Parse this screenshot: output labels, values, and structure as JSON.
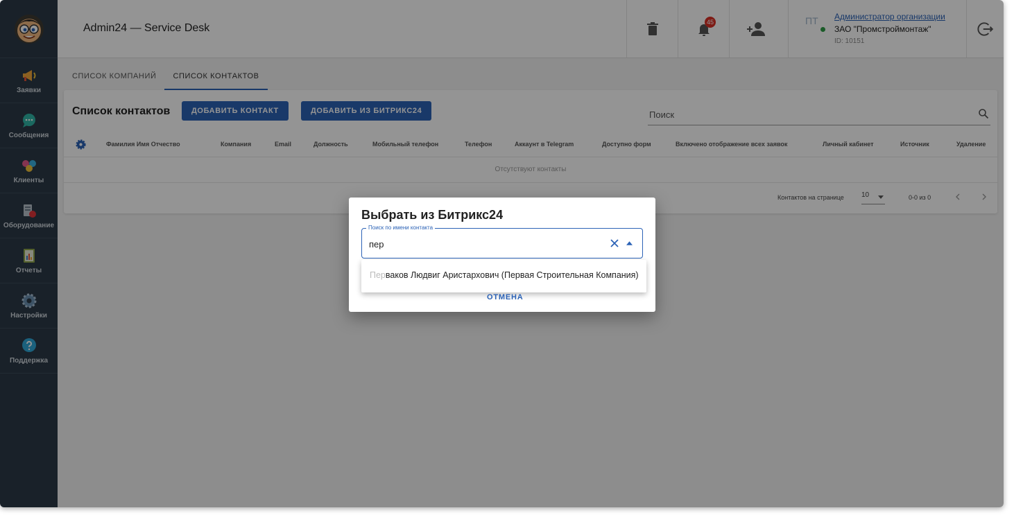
{
  "app": {
    "title": "Admin24 — Service Desk"
  },
  "sidebar": {
    "items": [
      {
        "label": "Заявки",
        "icon": "megaphone-icon"
      },
      {
        "label": "Сообщения",
        "icon": "chat-bubble-icon"
      },
      {
        "label": "Клиенты",
        "icon": "clients-icon"
      },
      {
        "label": "Оборудование",
        "icon": "equipment-icon"
      },
      {
        "label": "Отчеты",
        "icon": "report-icon"
      },
      {
        "label": "Настройки",
        "icon": "gear-icon"
      },
      {
        "label": "Поддержка",
        "icon": "help-icon"
      }
    ]
  },
  "header": {
    "notifications_count": "45",
    "user": {
      "initials": "ПТ",
      "role": "Администратор организации",
      "org": "ЗАО \"Промстроймонтаж\"",
      "id": "ID: 10151"
    }
  },
  "tabs": [
    {
      "label": "Список компаний",
      "active": false
    },
    {
      "label": "Список контактов",
      "active": true
    }
  ],
  "contacts": {
    "title": "Список контактов",
    "add_button": "Добавить контакт",
    "add_bitrix_button": "Добавить из Битрикс24",
    "search_placeholder": "Поиск",
    "columns": [
      "Фамилия Имя Отчество",
      "Компания",
      "Email",
      "Должность",
      "Мобильный телефон",
      "Телефон",
      "Аккаунт в Telegram",
      "Доступно форм",
      "Включено отображение всех заявок",
      "Личный кабинет",
      "Источник",
      "Удаление"
    ],
    "empty_text": "Отсутствуют контакты",
    "per_page_label": "Контактов на странице",
    "per_page_value": "10",
    "range_text": "0-0 из 0"
  },
  "dialog": {
    "title": "Выбрать из Битрикс24",
    "field_label": "Поиск по имени контакта",
    "field_value": "пер",
    "option_match": "Пер",
    "option_rest": "ваков Людвиг Аристархович (Первая Строительная Компания)",
    "cancel": "Отмена"
  },
  "colors": {
    "accent": "#2b62b6",
    "sidebar": "#2c3a47",
    "badge": "#d93025"
  }
}
